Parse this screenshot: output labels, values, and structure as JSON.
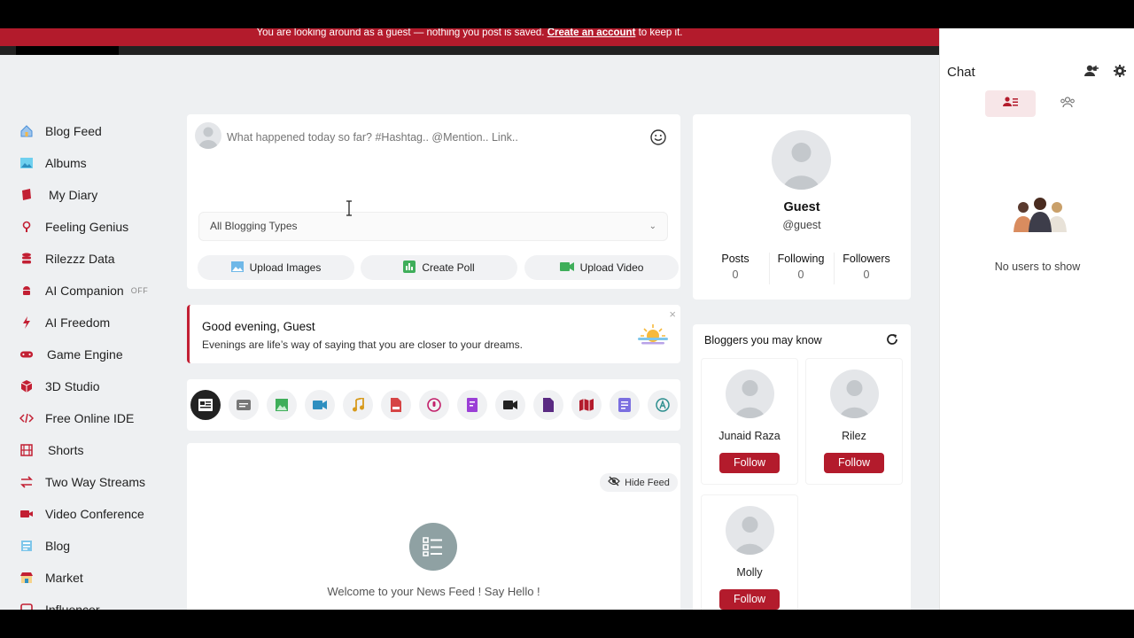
{
  "banner": {
    "text": "You are looking around as a guest — nothing you post is saved.",
    "link": "Create an account",
    "suffix": "to keep it."
  },
  "sidebar": {
    "items": [
      {
        "label": "Blog Feed",
        "icon": "home-icon",
        "color": "#4a90d9"
      },
      {
        "label": "Albums",
        "icon": "albums-icon",
        "color": "#2eaadc"
      },
      {
        "label": "My Diary",
        "icon": "diary-icon",
        "color": "#c21f33"
      },
      {
        "label": "Feeling Genius",
        "icon": "bulb-icon",
        "color": "#c21f33"
      },
      {
        "label": "Rilezzz Data",
        "icon": "database-icon",
        "color": "#c21f33"
      },
      {
        "label": "AI Companion",
        "icon": "android-icon",
        "color": "#c21f33",
        "badge": "OFF"
      },
      {
        "label": "AI Freedom",
        "icon": "bolt-icon",
        "color": "#c21f33"
      },
      {
        "label": "Game Engine",
        "icon": "gamepad-icon",
        "color": "#c21f33"
      },
      {
        "label": "3D Studio",
        "icon": "cube-icon",
        "color": "#c21f33"
      },
      {
        "label": "Free Online IDE",
        "icon": "code-icon",
        "color": "#c21f33"
      },
      {
        "label": "Shorts",
        "icon": "film-icon",
        "color": "#c21f33"
      },
      {
        "label": "Two Way Streams",
        "icon": "arrows-icon",
        "color": "#c21f33"
      },
      {
        "label": "Video Conference",
        "icon": "camera-icon",
        "color": "#c21f33"
      },
      {
        "label": "Blog",
        "icon": "blog-icon",
        "color": "#c21f33"
      },
      {
        "label": "Market",
        "icon": "market-icon",
        "color": "#c21f33"
      },
      {
        "label": "Influencer",
        "icon": "influencer-icon",
        "color": "#c21f33"
      }
    ]
  },
  "composer": {
    "placeholder": "What happened today so far? #Hashtag.. @Mention.. Link..",
    "blogging_types": "All Blogging Types",
    "upload_images": "Upload Images",
    "create_poll": "Create Poll",
    "upload_video": "Upload Video"
  },
  "greeting": {
    "title": "Good evening, Guest",
    "message": "Evenings are life’s way of saying that you are closer to your dreams.",
    "close": "×"
  },
  "filters": [
    "all-posts-icon",
    "text-post-icon",
    "image-post-icon",
    "video-post-icon",
    "music-post-icon",
    "pdf-post-icon",
    "audio-post-icon",
    "doc-post-icon",
    "clip-post-icon",
    "file-post-icon",
    "map-post-icon",
    "article-post-icon",
    "ai-post-icon"
  ],
  "feed": {
    "hide_label": "Hide Feed",
    "welcome": "Welcome to your News Feed ! Say Hello !"
  },
  "profile": {
    "name": "Guest",
    "handle": "@guest",
    "stats": [
      {
        "label": "Posts",
        "value": "0"
      },
      {
        "label": "Following",
        "value": "0"
      },
      {
        "label": "Followers",
        "value": "0"
      }
    ]
  },
  "bloggers": {
    "title": "Bloggers you may know",
    "follow_label": "Follow",
    "people": [
      "Junaid Raza",
      "Rilez",
      "Molly"
    ]
  },
  "chat": {
    "title": "Chat",
    "empty": "No users to show"
  },
  "colors": {
    "brand": "#b31b2c",
    "accent_light": "#f7e6e8",
    "background": "#eef0f2"
  }
}
